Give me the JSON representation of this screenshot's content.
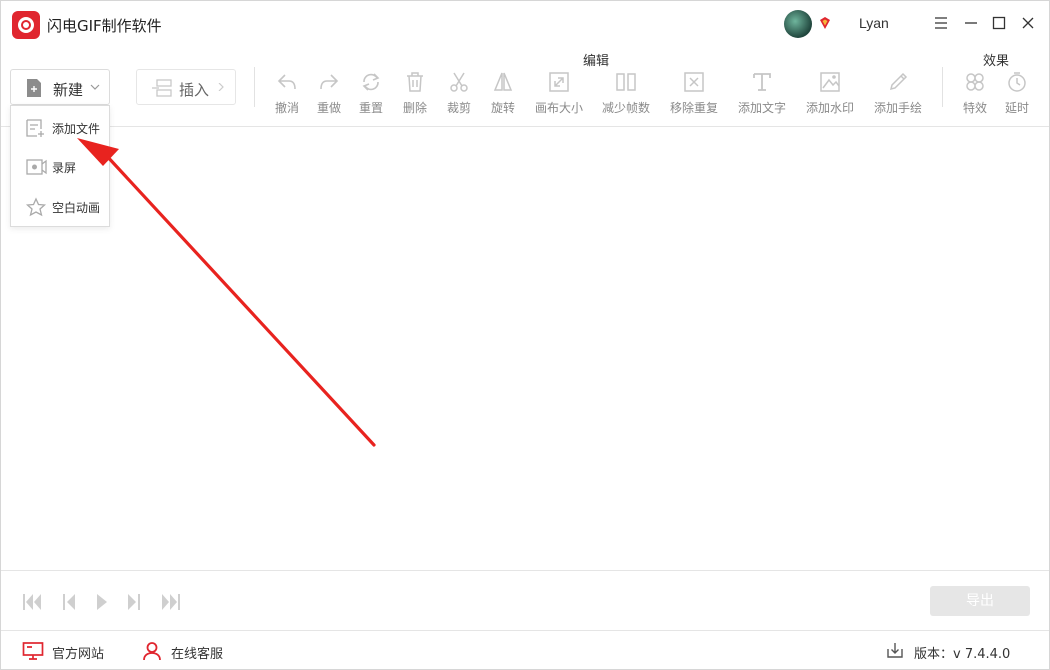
{
  "app": {
    "title": "闪电GIF制作软件",
    "brand_color": "#e0262f"
  },
  "user": {
    "name": "Lyan",
    "avatar_icon": "avatar",
    "vip_icon": "vip-diamond-icon"
  },
  "window_controls": [
    "menu-icon",
    "minimize-icon",
    "maximize-icon",
    "close-icon"
  ],
  "toolbar": {
    "new_label": "新建",
    "insert_label": "插入",
    "edit_section": "编辑",
    "effects_section": "效果",
    "edit_tools": [
      {
        "label": "撤消",
        "icon": "undo-icon"
      },
      {
        "label": "重做",
        "icon": "redo-icon"
      },
      {
        "label": "重置",
        "icon": "reset-icon"
      },
      {
        "label": "删除",
        "icon": "delete-icon"
      },
      {
        "label": "裁剪",
        "icon": "scissors-icon"
      },
      {
        "label": "旋转",
        "icon": "rotate-icon"
      },
      {
        "label": "画布大小",
        "icon": "canvas-size-icon"
      },
      {
        "label": "减少帧数",
        "icon": "reduce-frames-icon"
      },
      {
        "label": "移除重复",
        "icon": "remove-duplicates-icon"
      },
      {
        "label": "添加文字",
        "icon": "add-text-icon"
      },
      {
        "label": "添加水印",
        "icon": "add-watermark-icon"
      },
      {
        "label": "添加手绘",
        "icon": "add-drawing-icon"
      }
    ],
    "effect_tools": [
      {
        "label": "特效",
        "icon": "effects-icon"
      },
      {
        "label": "延时",
        "icon": "delay-icon"
      }
    ]
  },
  "new_menu": {
    "items": [
      {
        "label": "添加文件",
        "icon": "add-file-icon"
      },
      {
        "label": "录屏",
        "icon": "screen-record-icon"
      },
      {
        "label": "空白动画",
        "icon": "blank-animation-icon"
      }
    ]
  },
  "annotation": {
    "color": "#e8231f"
  },
  "playback": {
    "export_label": "导出",
    "export_bg": "#e6e6e6"
  },
  "footer": {
    "website_label": "官方网站",
    "support_label": "在线客服",
    "version_label": "版本：",
    "version_value": "v 7.4.4.0"
  }
}
